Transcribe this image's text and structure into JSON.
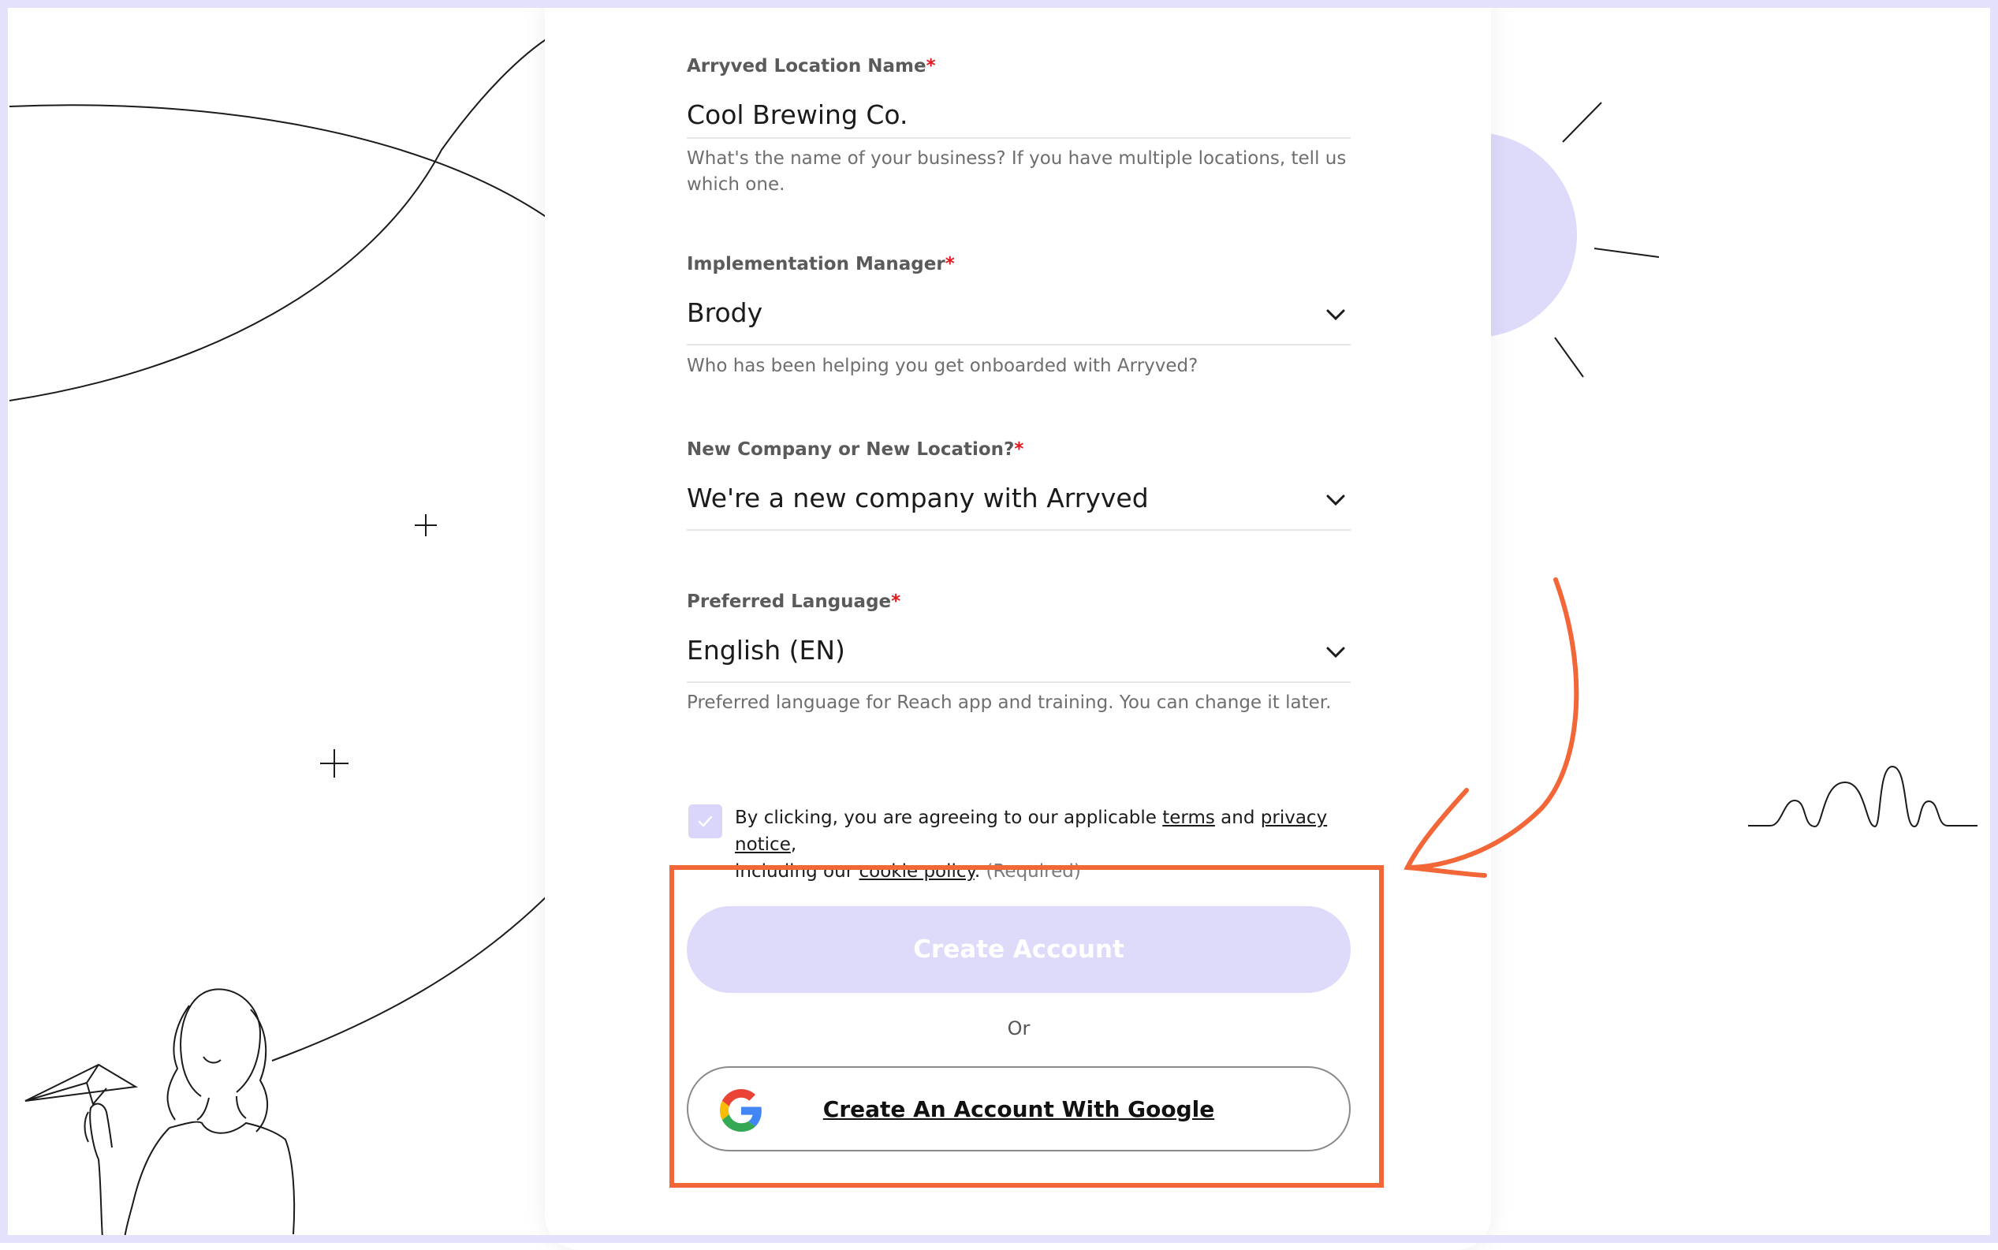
{
  "form": {
    "location_name": {
      "label": "Arryved Location Name",
      "required_mark": "*",
      "value": "Cool Brewing Co.",
      "help": "What's the name of your business? If you have multiple locations, tell us which one."
    },
    "implementation_manager": {
      "label": "Implementation Manager",
      "required_mark": "*",
      "value": "Brody",
      "help": "Who has been helping you get onboarded with Arryved?"
    },
    "company_or_location": {
      "label": "New Company or New Location?",
      "required_mark": "*",
      "value": "We're a new company with Arryved"
    },
    "preferred_language": {
      "label": "Preferred Language",
      "required_mark": "*",
      "value": "English (EN)",
      "help": "Preferred language for Reach app and training. You can change it later."
    },
    "consent": {
      "prefix": "By clicking, you are agreeing to our applicable ",
      "terms_link": "terms",
      "and": " and ",
      "privacy_link": "privacy notice",
      "comma": ",",
      "including": "including our ",
      "cookie_link": "cookie policy",
      "period": ".",
      "required_note": "(Required)",
      "checked": true
    },
    "create_button_label": "Create Account",
    "or_label": "Or",
    "google_button_label": "Create An Account With Google"
  },
  "icons": {
    "chevron": "chevron-down-icon",
    "check": "check-icon",
    "google": "google-logo-icon"
  },
  "colors": {
    "accent_light": "#dedbfa",
    "annotation": "#f26638",
    "frame": "#e4e1fb",
    "required": "#e0191f"
  }
}
